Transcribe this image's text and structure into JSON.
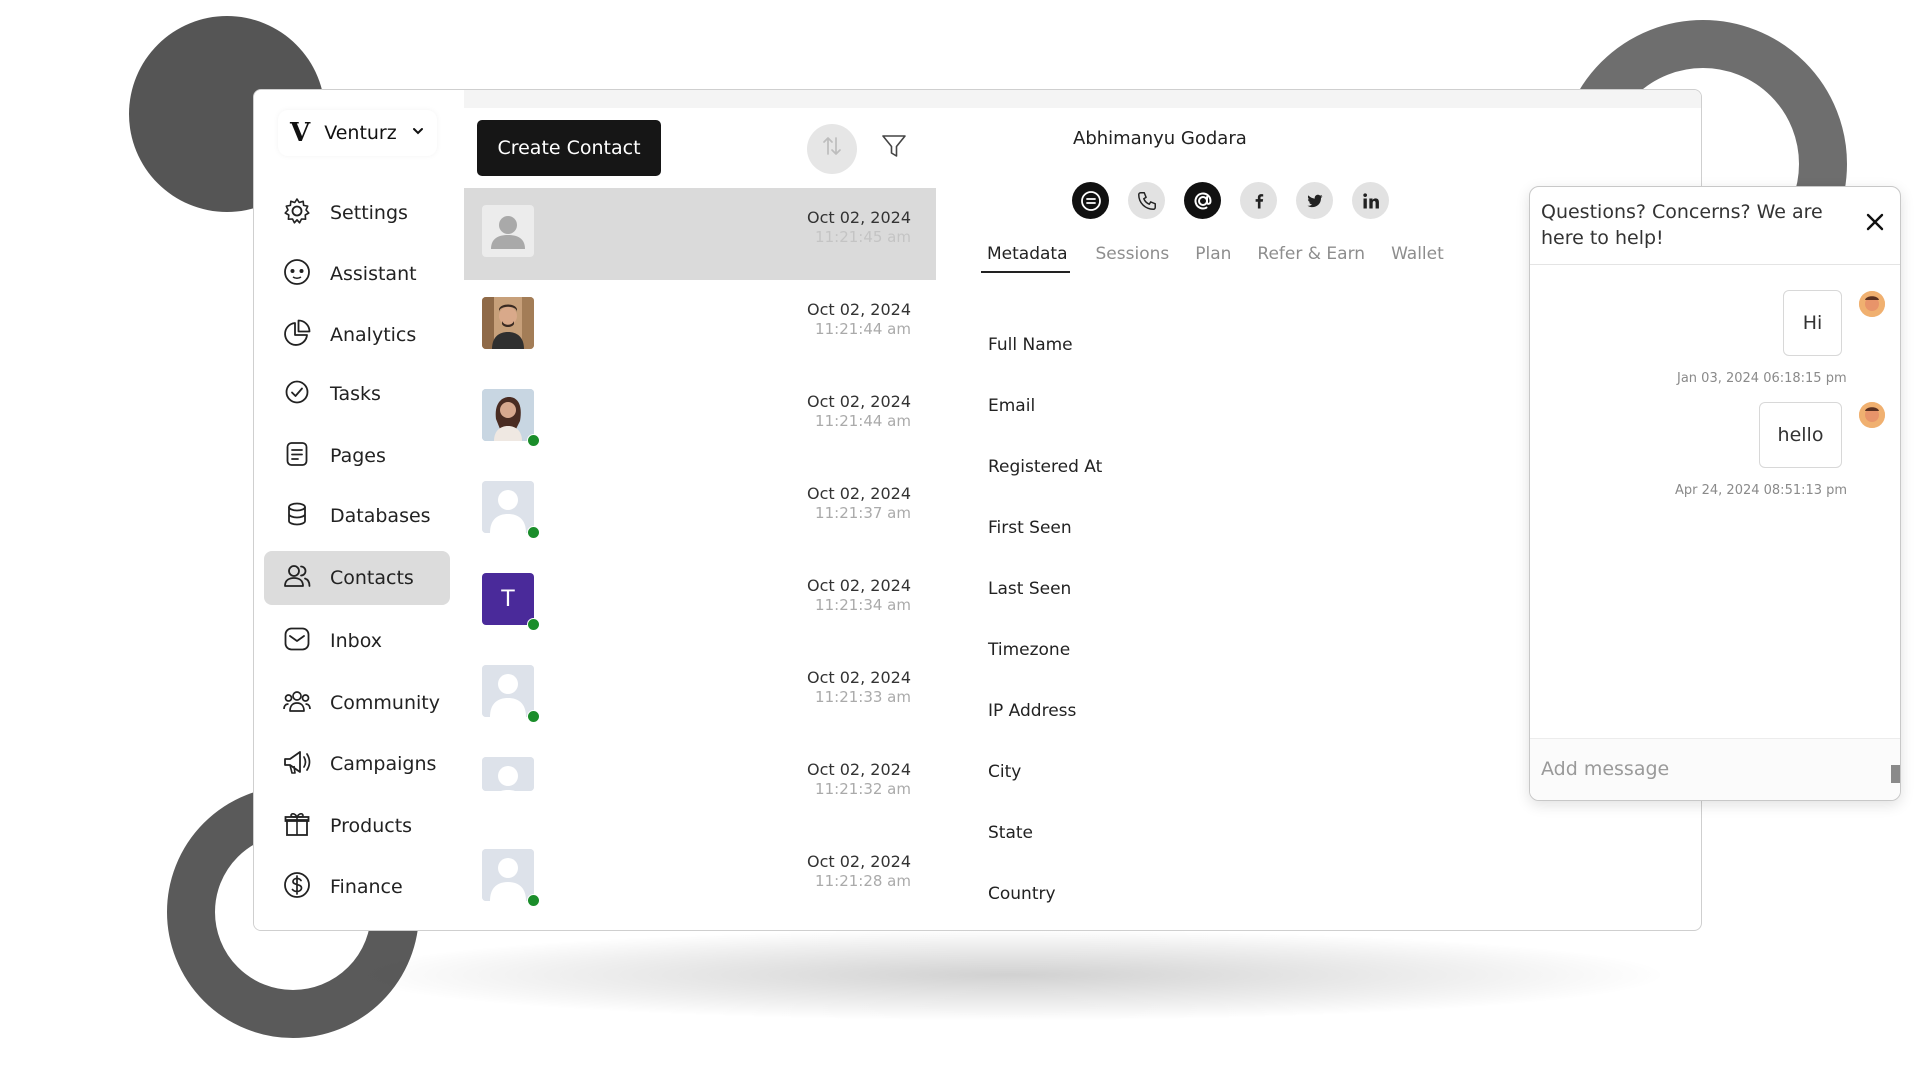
{
  "brand": {
    "logo": "V",
    "name": "Venturz",
    "chevron": "⌄"
  },
  "sidebar": {
    "items": [
      {
        "label": "Settings",
        "icon": "gear-icon"
      },
      {
        "label": "Assistant",
        "icon": "assistant-face-icon"
      },
      {
        "label": "Analytics",
        "icon": "pie-chart-icon"
      },
      {
        "label": "Tasks",
        "icon": "check-circle-icon"
      },
      {
        "label": "Pages",
        "icon": "page-icon"
      },
      {
        "label": "Databases",
        "icon": "database-icon"
      },
      {
        "label": "Contacts",
        "icon": "contacts-icon",
        "active": true
      },
      {
        "label": "Inbox",
        "icon": "inbox-icon"
      },
      {
        "label": "Community",
        "icon": "community-icon"
      },
      {
        "label": "Campaigns",
        "icon": "megaphone-icon"
      },
      {
        "label": "Products",
        "icon": "gift-icon"
      },
      {
        "label": "Finance",
        "icon": "dollar-circle-icon"
      }
    ]
  },
  "toolbar": {
    "create_label": "Create Contact",
    "sort_icon": "sort-icon",
    "filter_icon": "filter-icon"
  },
  "contacts": [
    {
      "date": "Oct 02, 2024",
      "time": "11:21:45 am",
      "avatar": "default-person",
      "online": false,
      "selected": true
    },
    {
      "date": "Oct 02, 2024",
      "time": "11:21:44 am",
      "avatar": "photo-man",
      "online": false
    },
    {
      "date": "Oct 02, 2024",
      "time": "11:21:44 am",
      "avatar": "photo-woman",
      "online": true
    },
    {
      "date": "Oct 02, 2024",
      "time": "11:21:37 am",
      "avatar": "placeholder",
      "online": true
    },
    {
      "date": "Oct 02, 2024",
      "time": "11:21:34 am",
      "avatar": "letter",
      "letter": "T",
      "online": true
    },
    {
      "date": "Oct 02, 2024",
      "time": "11:21:33 am",
      "avatar": "placeholder",
      "online": true
    },
    {
      "date": "Oct 02, 2024",
      "time": "11:21:32 am",
      "avatar": "placeholder",
      "online": false
    },
    {
      "date": "Oct 02, 2024",
      "time": "11:21:28 am",
      "avatar": "placeholder",
      "online": true
    }
  ],
  "detail": {
    "name": "Abhimanyu Godara",
    "social": [
      {
        "icon": "chat-icon",
        "glyph": "⊜",
        "dark": true
      },
      {
        "icon": "phone-icon",
        "glyph": "✆",
        "dark": false
      },
      {
        "icon": "at-icon",
        "glyph": "@",
        "dark": true
      },
      {
        "icon": "facebook-icon",
        "glyph": "f",
        "dark": false
      },
      {
        "icon": "twitter-icon",
        "glyph": "🐦",
        "dark": false
      },
      {
        "icon": "linkedin-icon",
        "glyph": "in",
        "dark": false
      }
    ],
    "tabs": [
      "Metadata",
      "Sessions",
      "Plan",
      "Refer & Earn",
      "Wallet"
    ],
    "active_tab": "Metadata",
    "fields": [
      "Full Name",
      "Email",
      "Registered At",
      "First Seen",
      "Last Seen",
      "Timezone",
      "IP Address",
      "City",
      "State",
      "Country"
    ]
  },
  "chat": {
    "title": "Questions? Concerns? We are here to help!",
    "close_icon": "close-icon",
    "messages": [
      {
        "text": "Hi",
        "time": "Jan 03, 2024 06:18:15 pm"
      },
      {
        "text": "hello",
        "time": "Apr 24, 2024 08:51:13 pm"
      }
    ],
    "input_placeholder": "Add message"
  }
}
